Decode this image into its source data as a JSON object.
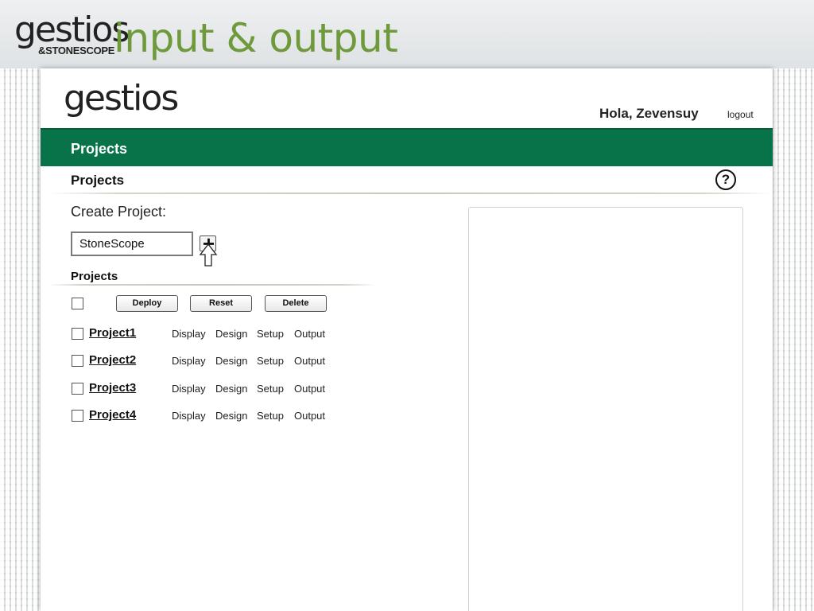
{
  "slide": {
    "brand_word": "gestios",
    "brand_sub": "&STONESCOPE",
    "title": "input & output",
    "title_color": "#6e9a3c"
  },
  "app": {
    "logo": "gestios",
    "greeting": "Hola, Zevensuy",
    "logout": "logout",
    "nav_title": "Projects",
    "nav_color": "#087349",
    "section_title": "Projects",
    "help_icon": "?",
    "create_label": "Create Project:",
    "create_input_value": "StoneScope",
    "add_icon": "+",
    "list_title": "Projects",
    "actions": {
      "deploy": "Deploy",
      "reset": "Reset",
      "delete": "Delete"
    },
    "row_links": {
      "display": "Display",
      "design": "Design",
      "setup": "Setup",
      "output": "Output"
    },
    "projects": [
      {
        "name": "Project1"
      },
      {
        "name": "Project2"
      },
      {
        "name": "Project3"
      },
      {
        "name": "Project4"
      }
    ]
  }
}
